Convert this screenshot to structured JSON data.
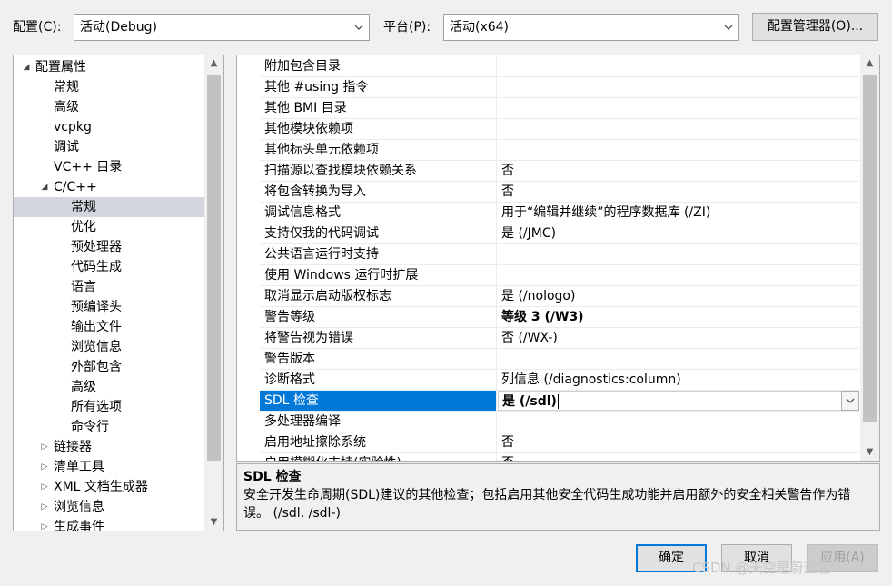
{
  "header": {
    "config_label": "配置(C):",
    "config_value": "活动(Debug)",
    "platform_label": "平台(P):",
    "platform_value": "活动(x64)",
    "config_manager_button": "配置管理器(O)..."
  },
  "tree": {
    "items": [
      {
        "label": "配置属性",
        "expander": "expanded"
      },
      {
        "label": "常规"
      },
      {
        "label": "高级"
      },
      {
        "label": "vcpkg"
      },
      {
        "label": "调试"
      },
      {
        "label": "VC++ 目录"
      },
      {
        "label": "C/C++",
        "expander": "expanded"
      },
      {
        "label": "常规",
        "selected": true
      },
      {
        "label": "优化"
      },
      {
        "label": "预处理器"
      },
      {
        "label": "代码生成"
      },
      {
        "label": "语言"
      },
      {
        "label": "预编译头"
      },
      {
        "label": "输出文件"
      },
      {
        "label": "浏览信息"
      },
      {
        "label": "外部包含"
      },
      {
        "label": "高级"
      },
      {
        "label": "所有选项"
      },
      {
        "label": "命令行"
      },
      {
        "label": "链接器",
        "expander": "collapsed"
      },
      {
        "label": "清单工具",
        "expander": "collapsed"
      },
      {
        "label": "XML 文档生成器",
        "expander": "collapsed"
      },
      {
        "label": "浏览信息",
        "expander": "collapsed"
      },
      {
        "label": "生成事件",
        "expander": "collapsed"
      }
    ]
  },
  "grid": {
    "rows": [
      {
        "name": "附加包含目录",
        "value": ""
      },
      {
        "name": "其他 #using 指令",
        "value": ""
      },
      {
        "name": "其他 BMI 目录",
        "value": ""
      },
      {
        "name": "其他模块依赖项",
        "value": ""
      },
      {
        "name": "其他标头单元依赖项",
        "value": ""
      },
      {
        "name": "扫描源以查找模块依赖关系",
        "value": "否"
      },
      {
        "name": "将包含转换为导入",
        "value": "否"
      },
      {
        "name": "调试信息格式",
        "value": "用于“编辑并继续”的程序数据库 (/ZI)"
      },
      {
        "name": "支持仅我的代码调试",
        "value": "是 (/JMC)"
      },
      {
        "name": "公共语言运行时支持",
        "value": ""
      },
      {
        "name": "使用 Windows 运行时扩展",
        "value": ""
      },
      {
        "name": "取消显示启动版权标志",
        "value": "是 (/nologo)"
      },
      {
        "name": "警告等级",
        "value": "等级 3 (/W3)",
        "bold": true
      },
      {
        "name": "将警告视为错误",
        "value": "否 (/WX-)"
      },
      {
        "name": "警告版本",
        "value": ""
      },
      {
        "name": "诊断格式",
        "value": "列信息 (/diagnostics:column)"
      },
      {
        "name": "SDL 检查",
        "value": "是 (/sdl)",
        "selected": true
      },
      {
        "name": "多处理器编译",
        "value": ""
      },
      {
        "name": "启用地址擦除系统",
        "value": "否"
      },
      {
        "name": "启用模糊化支持(实验性)",
        "value": "否"
      }
    ]
  },
  "description": {
    "title": "SDL 检查",
    "body": "安全开发生命周期(SDL)建议的其他检查；包括启用其他安全代码生成功能并启用额外的安全相关警告作为错误。     (/sdl, /sdl-)"
  },
  "footer": {
    "ok_button": "确定",
    "cancel_button": "取消",
    "apply_button": "应用(A)"
  },
  "watermark": "CSDN @天空是蔚蓝色",
  "colors": {
    "selection_blue": "#0078d7",
    "tree_selection": "#d3d6df",
    "dialog_background": "#f0f0f0"
  }
}
